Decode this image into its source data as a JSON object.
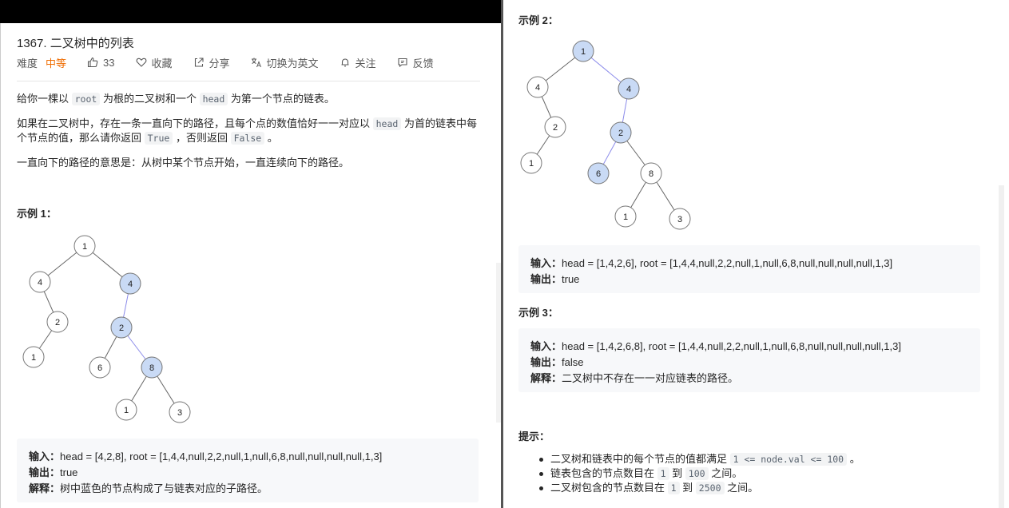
{
  "problem": {
    "title": "1367. 二叉树中的列表",
    "difficulty_label": "难度",
    "difficulty": "中等",
    "likes": "33",
    "favorite": "收藏",
    "share": "分享",
    "switch_lang": "切换为英文",
    "follow": "关注",
    "feedback": "反馈"
  },
  "desc": {
    "p1": [
      "给你一棵以 ",
      "root",
      " 为根的二叉树和一个 ",
      "head",
      " 为第一个节点的链表。"
    ],
    "p2": [
      "如果在二叉树中，存在一条一直向下的路径，且每个点的数值恰好一一对应以 ",
      "head",
      " 为首的链表中每个节点的值，那么请你返回 ",
      "True",
      " ，否则返回 ",
      "False",
      " 。"
    ],
    "p3": "一直向下的路径的意思是：从树中某个节点开始，一直连续向下的路径。"
  },
  "examples": [
    {
      "heading": "示例 1：",
      "input_label": "输入：",
      "input": "head = [4,2,8], root = [1,4,4,null,2,2,null,1,null,6,8,null,null,null,null,1,3]",
      "output_label": "输出：",
      "output": "true",
      "explain_label": "解释：",
      "explain": "树中蓝色的节点构成了与链表对应的子路径。"
    },
    {
      "heading": "示例 2：",
      "input_label": "输入：",
      "input": "head = [1,4,2,6], root = [1,4,4,null,2,2,null,1,null,6,8,null,null,null,null,1,3]",
      "output_label": "输出：",
      "output": "true"
    },
    {
      "heading": "示例 3：",
      "input_label": "输入：",
      "input": "head = [1,4,2,6,8], root = [1,4,4,null,2,2,null,1,null,6,8,null,null,null,null,1,3]",
      "output_label": "输出：",
      "output": "false",
      "explain_label": "解释：",
      "explain": "二叉树中不存在一一对应链表的路径。"
    }
  ],
  "tips": {
    "heading": "提示：",
    "items": [
      [
        "二叉树和链表中的每个节点的值都满足 ",
        "1 <= node.val <= 100",
        " 。"
      ],
      [
        "链表包含的节点数目在 ",
        "1",
        " 到 ",
        "100",
        " 之间。"
      ],
      [
        "二叉树包含的节点数目在 ",
        "1",
        " 到 ",
        "2500",
        " 之间。"
      ]
    ]
  },
  "tree": {
    "node_values": {
      "root": "1",
      "l": "4",
      "r": "4",
      "lr": "2",
      "lrl": "1",
      "rl": "2",
      "rll": "6",
      "rlr": "8",
      "rlrl": "1",
      "rlrr": "3"
    },
    "ex1_highlight": [
      "r",
      "rl",
      "rlr"
    ],
    "ex2_highlight": [
      "root",
      "r",
      "rl",
      "rll"
    ],
    "highlight_color": "#c9daf5",
    "edge_highlight_color": "#8b8bea"
  },
  "colors": {
    "difficulty": "#ef6c00",
    "code_bg": "#f2f3f4",
    "pre_bg": "#f7f8fa"
  }
}
